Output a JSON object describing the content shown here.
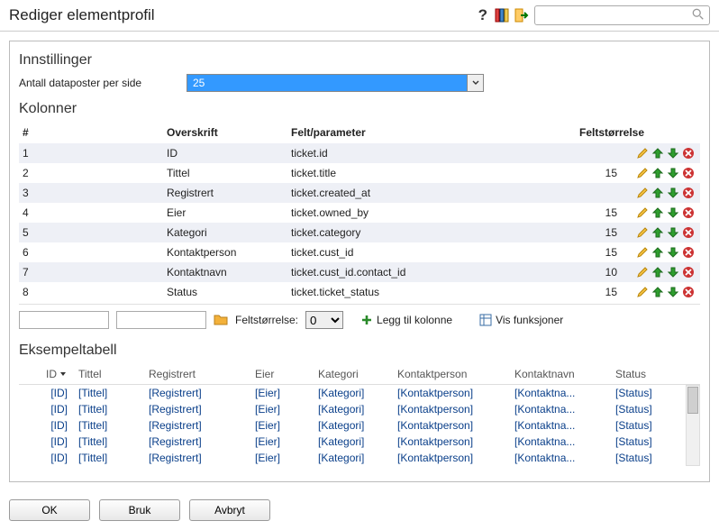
{
  "title": "Rediger elementprofil",
  "header": {
    "help": "?",
    "search_placeholder": ""
  },
  "settings": {
    "heading": "Innstillinger",
    "per_page_label": "Antall dataposter per side",
    "per_page_value": "25"
  },
  "columns": {
    "heading": "Kolonner",
    "head": {
      "num": "#",
      "overskrift": "Overskrift",
      "felt": "Felt/parameter",
      "storrelse": "Feltstørrelse"
    },
    "rows": [
      {
        "n": "1",
        "ov": "ID",
        "fp": "ticket.id",
        "fs": ""
      },
      {
        "n": "2",
        "ov": "Tittel",
        "fp": "ticket.title",
        "fs": "15"
      },
      {
        "n": "3",
        "ov": "Registrert",
        "fp": "ticket.created_at",
        "fs": ""
      },
      {
        "n": "4",
        "ov": "Eier",
        "fp": "ticket.owned_by",
        "fs": "15"
      },
      {
        "n": "5",
        "ov": "Kategori",
        "fp": "ticket.category",
        "fs": "15"
      },
      {
        "n": "6",
        "ov": "Kontaktperson",
        "fp": "ticket.cust_id",
        "fs": "15"
      },
      {
        "n": "7",
        "ov": "Kontaktnavn",
        "fp": "ticket.cust_id.contact_id",
        "fs": "10"
      },
      {
        "n": "8",
        "ov": "Status",
        "fp": "ticket.ticket_status",
        "fs": "15"
      }
    ]
  },
  "toolbar": {
    "felt_label": "Feltstørrelse:",
    "felt_value": "0",
    "add_label": "Legg til kolonne",
    "func_label": "Vis funksjoner"
  },
  "sample": {
    "heading": "Eksempeltabell",
    "head": {
      "id": "ID",
      "tittel": "Tittel",
      "reg": "Registrert",
      "eier": "Eier",
      "kat": "Kategori",
      "kp": "Kontaktperson",
      "kn": "Kontaktnavn",
      "st": "Status"
    },
    "cell": {
      "id": "[ID]",
      "tittel": "[Tittel]",
      "reg": "[Registrert]",
      "eier": "[Eier]",
      "kat": "[Kategori]",
      "kp": "[Kontaktperson]",
      "kn": "[Kontaktna...",
      "st": "[Status]"
    },
    "row_count": 5
  },
  "footer": {
    "ok": "OK",
    "bruk": "Bruk",
    "avbryt": "Avbryt"
  },
  "icons": {
    "pencil": "pencil-icon",
    "up": "arrow-up-icon",
    "down": "arrow-down-icon",
    "delete": "delete-icon"
  }
}
